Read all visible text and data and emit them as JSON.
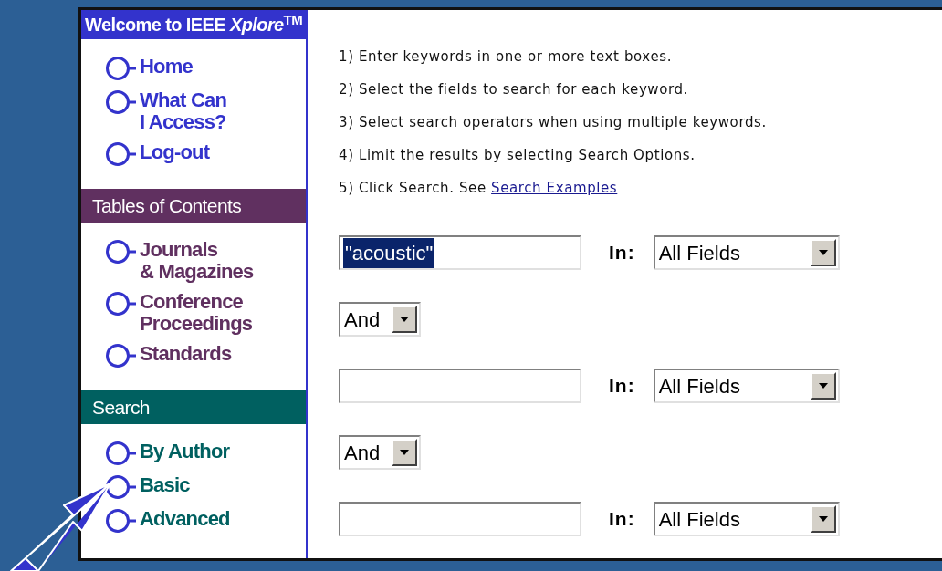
{
  "sidebar": {
    "title": "Welcome to IEEE *Xplore*$^{TM}$",
    "sections": [
      {
        "color": "#3333cc",
        "items": [
          {
            "label": "Home"
          },
          {
            "label": "What Can\nI Access?"
          },
          {
            "label": "Log-out"
          }
        ]
      },
      {
        "title": "Tables of Contents",
        "color": "#603060",
        "items": [
          {
            "label": "Journals\n& Magazines"
          },
          {
            "label": "Conference\nProceedings"
          },
          {
            "label": "Standards"
          }
        ]
      },
      {
        "title": "Search",
        "color": "#006060",
        "items": [
          {
            "label": "By Author"
          },
          {
            "label": "Basic"
          },
          {
            "label": "Advanced"
          }
        ]
      }
    ]
  },
  "instructions": [
    {
      "text": "1) Enter keywords in one or more text boxes."
    },
    {
      "text": "2) Select the fields to search for each keyword."
    },
    {
      "text": "3) Select search operators when using multiple keywords."
    },
    {
      "text": "4) Limit the results by selecting Search Options."
    },
    {
      "text": "5) Click Search. See ",
      "link": "Search Examples"
    }
  ],
  "search_rows": [
    {
      "kind": "keyword",
      "value": "\"acoustic\"",
      "selected": true,
      "in_label": "In:",
      "field": "All Fields"
    },
    {
      "kind": "operator",
      "operator": "And"
    },
    {
      "kind": "keyword",
      "in_label": "In:",
      "field": "All Fields"
    },
    {
      "kind": "operator",
      "operator": "And"
    },
    {
      "kind": "keyword",
      "in_label": "In:",
      "field": "All Fields"
    }
  ]
}
